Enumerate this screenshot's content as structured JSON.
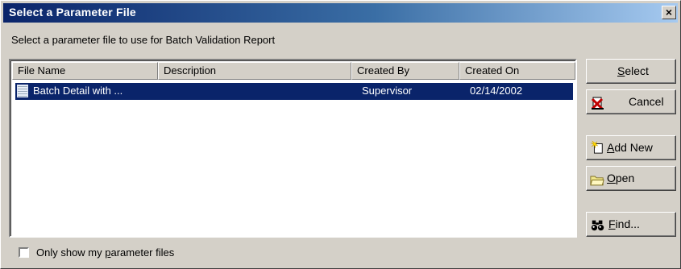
{
  "dialog": {
    "title": "Select a Parameter File",
    "close_glyph": "×",
    "prompt": "Select a parameter file to use for Batch Validation Report"
  },
  "list": {
    "columns": [
      {
        "label": "File Name"
      },
      {
        "label": "Description"
      },
      {
        "label": "Created By"
      },
      {
        "label": "Created On"
      }
    ],
    "rows": [
      {
        "file_name": "Batch Detail with ...",
        "description": "",
        "created_by": "Supervisor",
        "created_on": "02/14/2002",
        "selected": true,
        "icon": "document-icon"
      }
    ]
  },
  "buttons": {
    "select": {
      "label": "Select",
      "mnemonic": "S"
    },
    "cancel": {
      "label": "Cancel",
      "icon": "cancel-icon"
    },
    "add_new": {
      "label": "Add New",
      "mnemonic": "A",
      "icon": "new-document-icon"
    },
    "open": {
      "label": "Open",
      "mnemonic": "O",
      "icon": "open-folder-icon"
    },
    "find": {
      "label": "Find...",
      "mnemonic": "F",
      "icon": "binoculars-icon"
    }
  },
  "filter": {
    "label": "Only show my parameter files",
    "mnemonic": "p",
    "checked": false
  },
  "colors": {
    "title_start": "#0a246a",
    "title_end": "#a6caf0",
    "selection": "#0a246a",
    "face": "#d4d0c8"
  }
}
